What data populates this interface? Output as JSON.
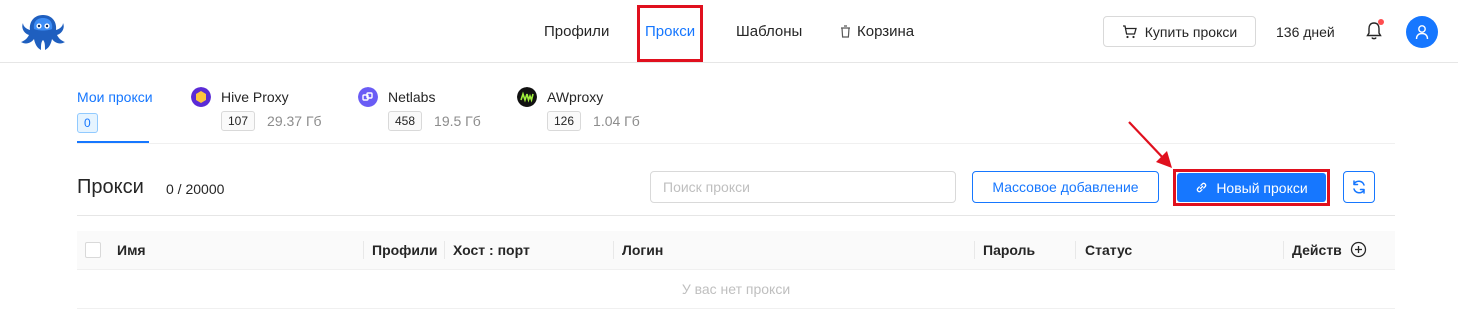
{
  "header": {
    "nav": [
      {
        "label": "Профили"
      },
      {
        "label": "Прокси",
        "active": true
      },
      {
        "label": "Шаблоны"
      },
      {
        "label": "Корзина",
        "icon": "trash-icon"
      }
    ],
    "buy_label": "Купить прокси",
    "days": "136 дней"
  },
  "tabs": [
    {
      "label": "Мои прокси",
      "count": "0",
      "active": true
    },
    {
      "label": "Hive Proxy",
      "count": "107",
      "size": "29.37 Гб",
      "icon": "hive-proxy-icon"
    },
    {
      "label": "Netlabs",
      "count": "458",
      "size": "19.5 Гб",
      "icon": "netlabs-icon"
    },
    {
      "label": "AWproxy",
      "count": "126",
      "size": "1.04 Гб",
      "icon": "awproxy-icon"
    }
  ],
  "section": {
    "title": "Прокси",
    "count": "0 / 20000",
    "search_placeholder": "Поиск прокси",
    "bulk_label": "Массовое добавление",
    "new_label": "Новый прокси"
  },
  "table": {
    "columns": [
      "Имя",
      "Профили",
      "Хост : порт",
      "Логин",
      "Пароль",
      "Статус",
      "Действия"
    ],
    "empty_text": "У вас нет прокси"
  },
  "colors": {
    "accent": "#1677ff",
    "highlight": "#e0101e"
  }
}
